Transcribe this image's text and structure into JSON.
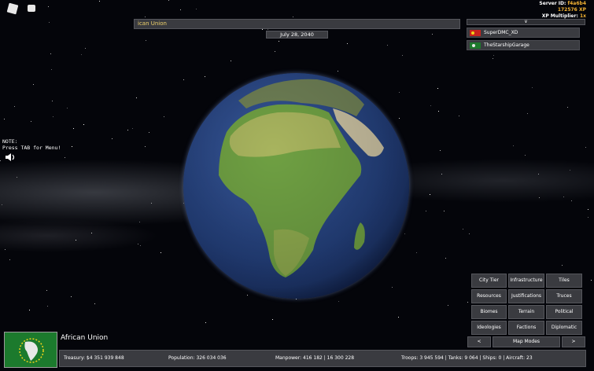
{
  "server": {
    "id_label": "Server ID:",
    "id_value": "f4a6b4",
    "xp_value": "172576",
    "xp_label": "XP",
    "multiplier_label": "XP Multiplier:",
    "multiplier_value": "1x"
  },
  "top": {
    "country_name": "ican Union",
    "date": "July 28, 2040"
  },
  "players": {
    "toggle": "∨",
    "list": [
      {
        "name": "SuperDMC_XD",
        "flag_color": "#c8231e"
      },
      {
        "name": "TheStarshipGarage",
        "flag_color": "#1e7a2d"
      }
    ]
  },
  "note": {
    "line1": "NOTE:",
    "line2": "Press TAB for Menu!"
  },
  "menu": {
    "city_tier": "City Tier",
    "infrastructure": "Infrastructure",
    "tiles": "Tiles",
    "resources": "Resources",
    "justifications": "Justifications",
    "truces": "Truces",
    "biomes": "Biomes",
    "terrain": "Terrain",
    "political": "Political",
    "ideologies": "Ideologies",
    "factions": "Factions",
    "diplomatic": "Diplomatic",
    "prev": "<",
    "map_modes": "Map Modes",
    "next": ">"
  },
  "country": {
    "name": "African Union"
  },
  "stats": {
    "treasury": "Treasury:  $4 351 939 848",
    "population": "Population: 326 034 036",
    "manpower": "Manpower: 416 182  |  16 300 228",
    "military": "Troops: 3 945 594  |  Tanks: 9 064  |  Ships: 0  |  Aircraft: 23"
  },
  "colors": {
    "accent_gold": "#f2b233",
    "panel": "#3a3b40",
    "ocean": "#233f7a",
    "land_green": "#5f9a3a",
    "land_desert": "#c9c27a"
  }
}
